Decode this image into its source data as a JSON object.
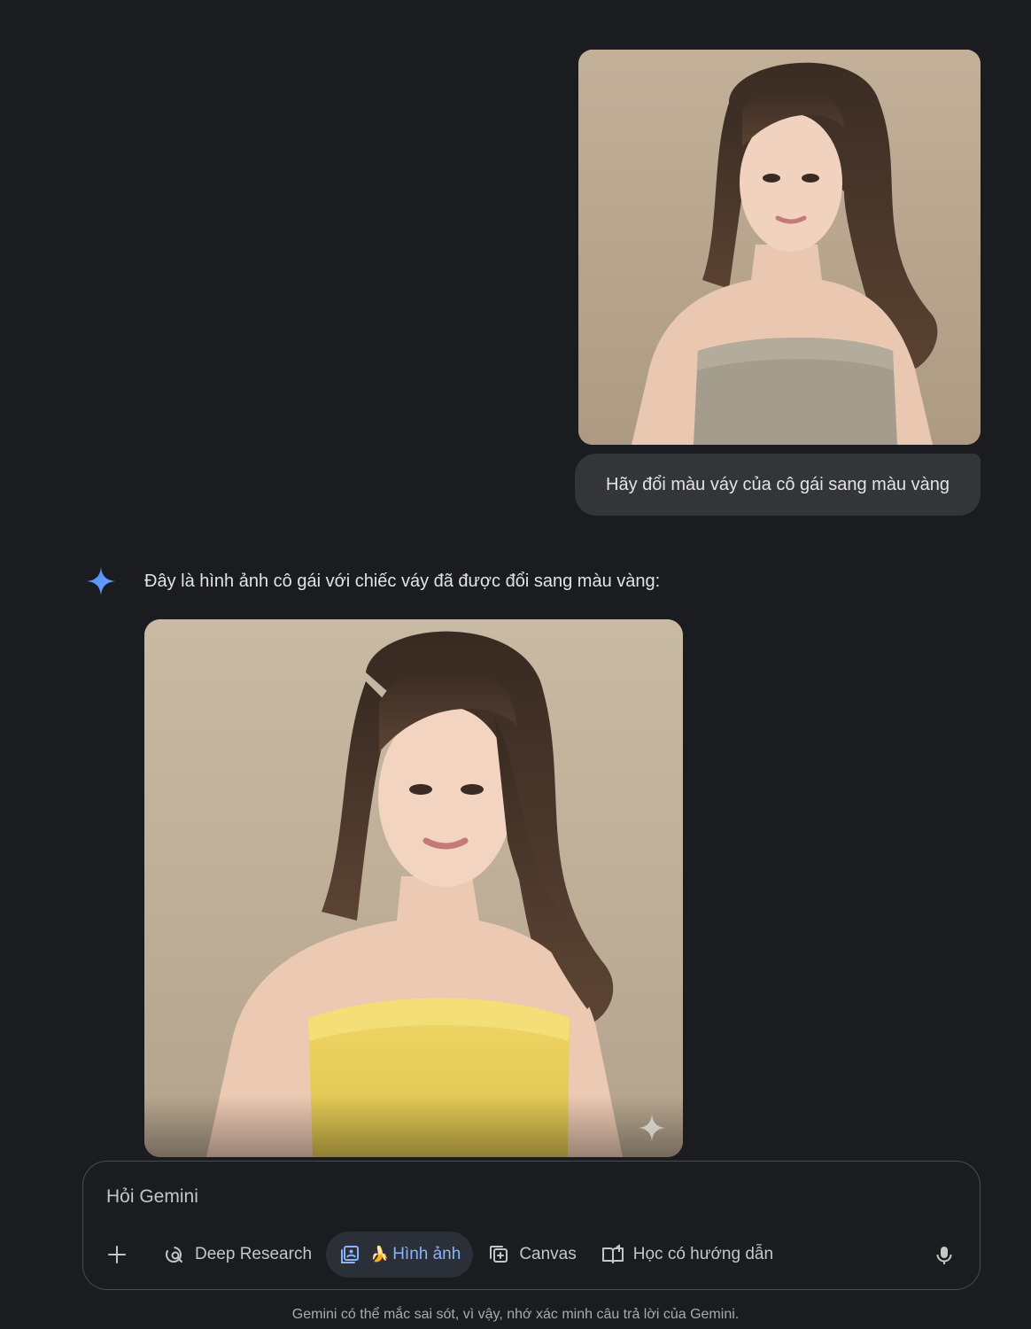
{
  "conversation": {
    "user_message": {
      "image_alt": "user-uploaded-photo",
      "text": "Hãy đổi màu váy của cô gái sang màu vàng"
    },
    "model_response": {
      "text": "Đây là hình ảnh cô gái với chiếc váy đã được đổi sang màu vàng:",
      "image_alt": "generated-photo-yellow-dress"
    }
  },
  "composer": {
    "placeholder": "Hỏi Gemini",
    "tools": [
      {
        "label": "Deep Research",
        "icon": "deep-research-icon"
      },
      {
        "label": "Hình ảnh",
        "icon": "image-icon",
        "prefix_icon": "banana-icon",
        "active": true
      },
      {
        "label": "Canvas",
        "icon": "canvas-icon"
      },
      {
        "label": "Học có hướng dẫn",
        "icon": "book-icon"
      }
    ]
  },
  "footer": {
    "disclaimer": "Gemini có thể mắc sai sót, vì vậy, nhớ xác minh câu trả lời của Gemini."
  },
  "colors": {
    "background": "#1b1c1f",
    "bubble": "#333538",
    "accent": "#8ab4f8",
    "active_chip": "#2b2f38",
    "dress_yellow": "#e8cf5a",
    "dress_original": "#a49c8c"
  }
}
